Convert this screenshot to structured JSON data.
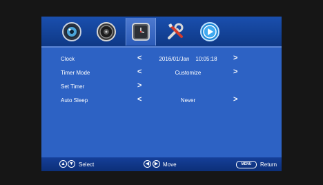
{
  "tabs": [
    {
      "icon": "picture-icon"
    },
    {
      "icon": "speaker-icon"
    },
    {
      "icon": "clock-icon",
      "active": true
    },
    {
      "icon": "tools-icon"
    },
    {
      "icon": "media-play-icon"
    }
  ],
  "menu": {
    "rows": [
      {
        "label": "Clock",
        "value": "2016/01/Jan    10:05:18",
        "left_arrow": "<",
        "right_arrow": ">"
      },
      {
        "label": "Timer Mode",
        "value": "Customize",
        "left_arrow": "<",
        "right_arrow": ">"
      },
      {
        "label": "Set Timer",
        "value": "",
        "left_arrow": ">",
        "right_arrow": ""
      },
      {
        "label": "Auto Sleep",
        "value": "Never",
        "left_arrow": "<",
        "right_arrow": ">"
      }
    ]
  },
  "footer": {
    "select_label": "Select",
    "move_label": "Move",
    "menu_key": "MENU",
    "return_label": "Return"
  },
  "colors": {
    "background": "#161616",
    "menu_bg": "#2d62c4",
    "tabbar": "#123f96"
  }
}
